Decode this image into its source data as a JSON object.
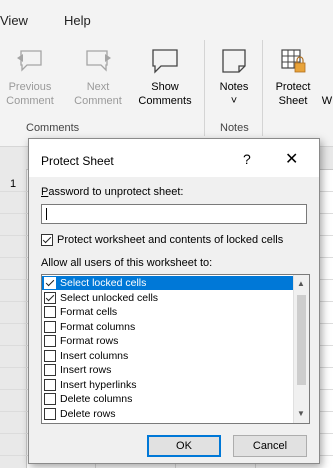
{
  "ribbon": {
    "tabs": [
      "View",
      "Help"
    ],
    "buttons": {
      "previous": [
        "Previous",
        "Comment"
      ],
      "next": [
        "Next",
        "Comment"
      ],
      "show": [
        "Show",
        "Comments"
      ],
      "notes": [
        "Notes",
        "˅"
      ],
      "protect": [
        "Protect",
        "Sheet"
      ],
      "partial": [
        "W"
      ]
    },
    "groups": [
      "Comments",
      "Notes"
    ]
  },
  "sheet": {
    "row_marker": "1"
  },
  "dialog": {
    "title": "Protect Sheet",
    "help": "?",
    "close": "✕",
    "password_label": "Password to unprotect sheet:",
    "password_value": "",
    "protect_contents": {
      "label": "Protect worksheet and contents of locked cells",
      "checked": true
    },
    "allow_label": "Allow all users of this worksheet to:",
    "permissions": [
      {
        "label": "Select locked cells",
        "checked": true,
        "selected": true
      },
      {
        "label": "Select unlocked cells",
        "checked": true,
        "selected": false
      },
      {
        "label": "Format cells",
        "checked": false,
        "selected": false
      },
      {
        "label": "Format columns",
        "checked": false,
        "selected": false
      },
      {
        "label": "Format rows",
        "checked": false,
        "selected": false
      },
      {
        "label": "Insert columns",
        "checked": false,
        "selected": false
      },
      {
        "label": "Insert rows",
        "checked": false,
        "selected": false
      },
      {
        "label": "Insert hyperlinks",
        "checked": false,
        "selected": false
      },
      {
        "label": "Delete columns",
        "checked": false,
        "selected": false
      },
      {
        "label": "Delete rows",
        "checked": false,
        "selected": false
      }
    ],
    "ok_label": "OK",
    "cancel_label": "Cancel"
  }
}
